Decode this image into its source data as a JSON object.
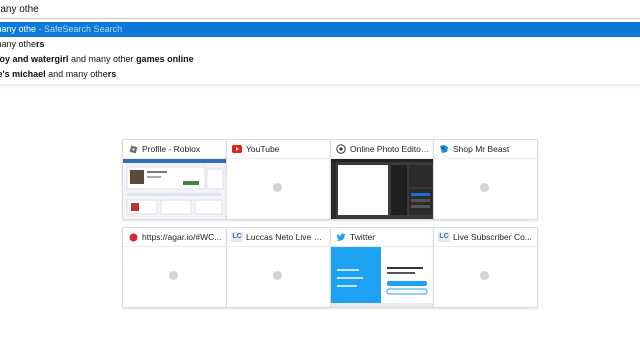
{
  "urlbar": {
    "value": "many othe"
  },
  "suggestions": [
    {
      "parts": [
        {
          "t": "many othe",
          "b": false
        }
      ],
      "hint": " - SafeSearch Search",
      "selected": true
    },
    {
      "parts": [
        {
          "t": "many othe",
          "b": false
        },
        {
          "t": "rs",
          "b": true
        }
      ],
      "hint": "",
      "selected": false
    },
    {
      "parts": [
        {
          "t": "boy and watergirl",
          "b": true
        },
        {
          "t": " and many other ",
          "b": false
        },
        {
          "t": "games online",
          "b": true
        }
      ],
      "hint": "",
      "selected": false
    },
    {
      "parts": [
        {
          "t": "re's michael",
          "b": true
        },
        {
          "t": " and many othe",
          "b": false
        },
        {
          "t": "rs",
          "b": true
        }
      ],
      "hint": "",
      "selected": false
    }
  ],
  "tiles": [
    {
      "label": "Profile - Roblox",
      "icon": "roblox-icon"
    },
    {
      "label": "YouTube",
      "icon": "youtube-icon"
    },
    {
      "label": "Online Photo Editor ...",
      "icon": "photo-editor-icon"
    },
    {
      "label": "Shop Mr Beast",
      "icon": "mrbeast-icon"
    },
    {
      "label": "https://agar.io/#WC...",
      "icon": "agar-icon"
    },
    {
      "label": "Luccas Neto Live S...",
      "icon": "lc-icon",
      "icon_text": "LC"
    },
    {
      "label": "Twitter",
      "icon": "twitter-icon"
    },
    {
      "label": "Live Subscriber Co...",
      "icon": "lc-icon",
      "icon_text": "LC"
    }
  ]
}
